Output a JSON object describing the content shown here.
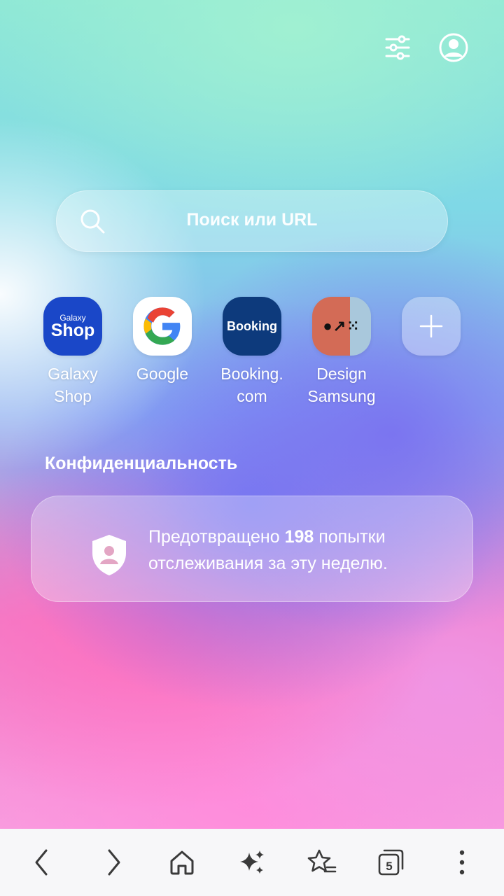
{
  "search": {
    "placeholder": "Поиск или URL"
  },
  "quick_access": [
    {
      "label": "Galaxy\nShop",
      "icon_text_top": "Galaxy",
      "icon_text_bottom": "Shop",
      "icon_color": "#1a47c8"
    },
    {
      "label": "Google",
      "icon": "google-g-logo"
    },
    {
      "label": "Booking.\ncom",
      "icon_text": "Booking",
      "icon_color": "#0d3a7c"
    },
    {
      "label": "Design\nSamsung",
      "icon_text": "●↗⁙",
      "icon_color": "#d36b56"
    },
    {
      "label": "",
      "icon": "plus-icon"
    }
  ],
  "privacy": {
    "title": "Конфиденциальность",
    "text_before": "Предотвращено ",
    "count": "198",
    "text_after": " попытки отслеживания за эту неделю."
  },
  "bottom_nav": {
    "tabs_count": "5",
    "icons": [
      "back-icon",
      "forward-icon",
      "home-icon",
      "ai-sparkle-icon",
      "bookmarks-icon",
      "tabs-icon",
      "more-icon"
    ]
  }
}
